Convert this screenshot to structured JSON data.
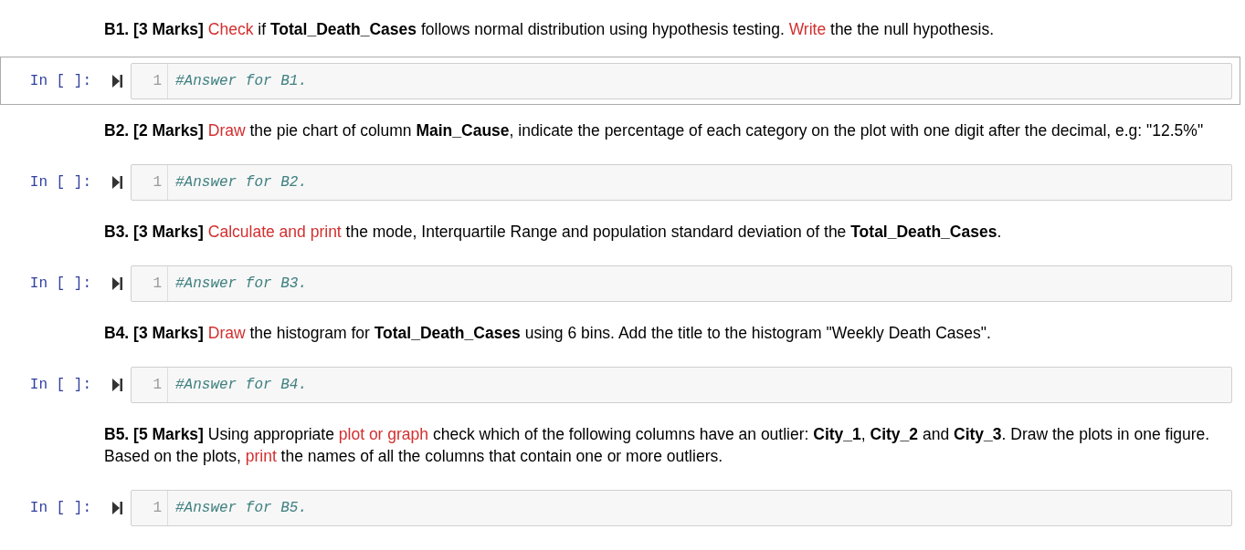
{
  "cells": [
    {
      "kind": "markdown",
      "runs": [
        {
          "kind": "bold",
          "text": "B1. [3 Marks]"
        },
        {
          "kind": "highlight",
          "text": " Check"
        },
        {
          "kind": "plain",
          "text": " if "
        },
        {
          "kind": "bold",
          "text": "Total_Death_Cases"
        },
        {
          "kind": "plain",
          "text": " follows normal distribution using hypothesis testing. "
        },
        {
          "kind": "highlight",
          "text": "Write"
        },
        {
          "kind": "plain",
          "text": " the the null hypothesis."
        }
      ]
    },
    {
      "kind": "code",
      "prompt": "In [ ]:",
      "selected": true,
      "lines": [
        {
          "number": "1",
          "code": "#Answer for B1."
        }
      ]
    },
    {
      "kind": "markdown",
      "runs": [
        {
          "kind": "bold",
          "text": "B2. [2 Marks]"
        },
        {
          "kind": "highlight",
          "text": " Draw"
        },
        {
          "kind": "plain",
          "text": " the pie chart of column "
        },
        {
          "kind": "bold",
          "text": "Main_Cause"
        },
        {
          "kind": "plain",
          "text": ", indicate the percentage of each category on the plot with one digit after the decimal, e.g: \"12.5%\""
        }
      ]
    },
    {
      "kind": "code",
      "prompt": "In [ ]:",
      "selected": false,
      "lines": [
        {
          "number": "1",
          "code": "#Answer for B2."
        }
      ]
    },
    {
      "kind": "markdown",
      "runs": [
        {
          "kind": "bold",
          "text": "B3. [3 Marks]"
        },
        {
          "kind": "highlight",
          "text": " Calculate and print"
        },
        {
          "kind": "plain",
          "text": " the mode, Interquartile Range and population standard deviation of the "
        },
        {
          "kind": "bold",
          "text": "Total_Death_Cases"
        },
        {
          "kind": "plain",
          "text": "."
        }
      ]
    },
    {
      "kind": "code",
      "prompt": "In [ ]:",
      "selected": false,
      "lines": [
        {
          "number": "1",
          "code": "#Answer for B3."
        }
      ]
    },
    {
      "kind": "markdown",
      "runs": [
        {
          "kind": "bold",
          "text": "B4. [3 Marks]"
        },
        {
          "kind": "highlight",
          "text": " Draw"
        },
        {
          "kind": "plain",
          "text": " the histogram for "
        },
        {
          "kind": "bold",
          "text": "Total_Death_Cases"
        },
        {
          "kind": "plain",
          "text": " using 6 bins. Add the title to the histogram \"Weekly Death Cases\"."
        }
      ]
    },
    {
      "kind": "code",
      "prompt": "In [ ]:",
      "selected": false,
      "lines": [
        {
          "number": "1",
          "code": "#Answer for B4."
        }
      ]
    },
    {
      "kind": "markdown",
      "runs": [
        {
          "kind": "bold",
          "text": "B5. [5 Marks]"
        },
        {
          "kind": "plain",
          "text": " Using appropriate "
        },
        {
          "kind": "highlight",
          "text": "plot or graph"
        },
        {
          "kind": "plain",
          "text": " check which of the following columns have an outlier: "
        },
        {
          "kind": "bold",
          "text": "City_1"
        },
        {
          "kind": "plain",
          "text": ", "
        },
        {
          "kind": "bold",
          "text": "City_2"
        },
        {
          "kind": "plain",
          "text": " and "
        },
        {
          "kind": "bold",
          "text": "City_3"
        },
        {
          "kind": "plain",
          "text": ". Draw the plots in one figure. Based on the plots, "
        },
        {
          "kind": "highlight",
          "text": "print"
        },
        {
          "kind": "plain",
          "text": " the names of all the columns that contain one or more outliers."
        }
      ]
    },
    {
      "kind": "code",
      "prompt": "In [ ]:",
      "selected": false,
      "lines": [
        {
          "number": "1",
          "code": "#Answer for B5."
        }
      ]
    }
  ]
}
